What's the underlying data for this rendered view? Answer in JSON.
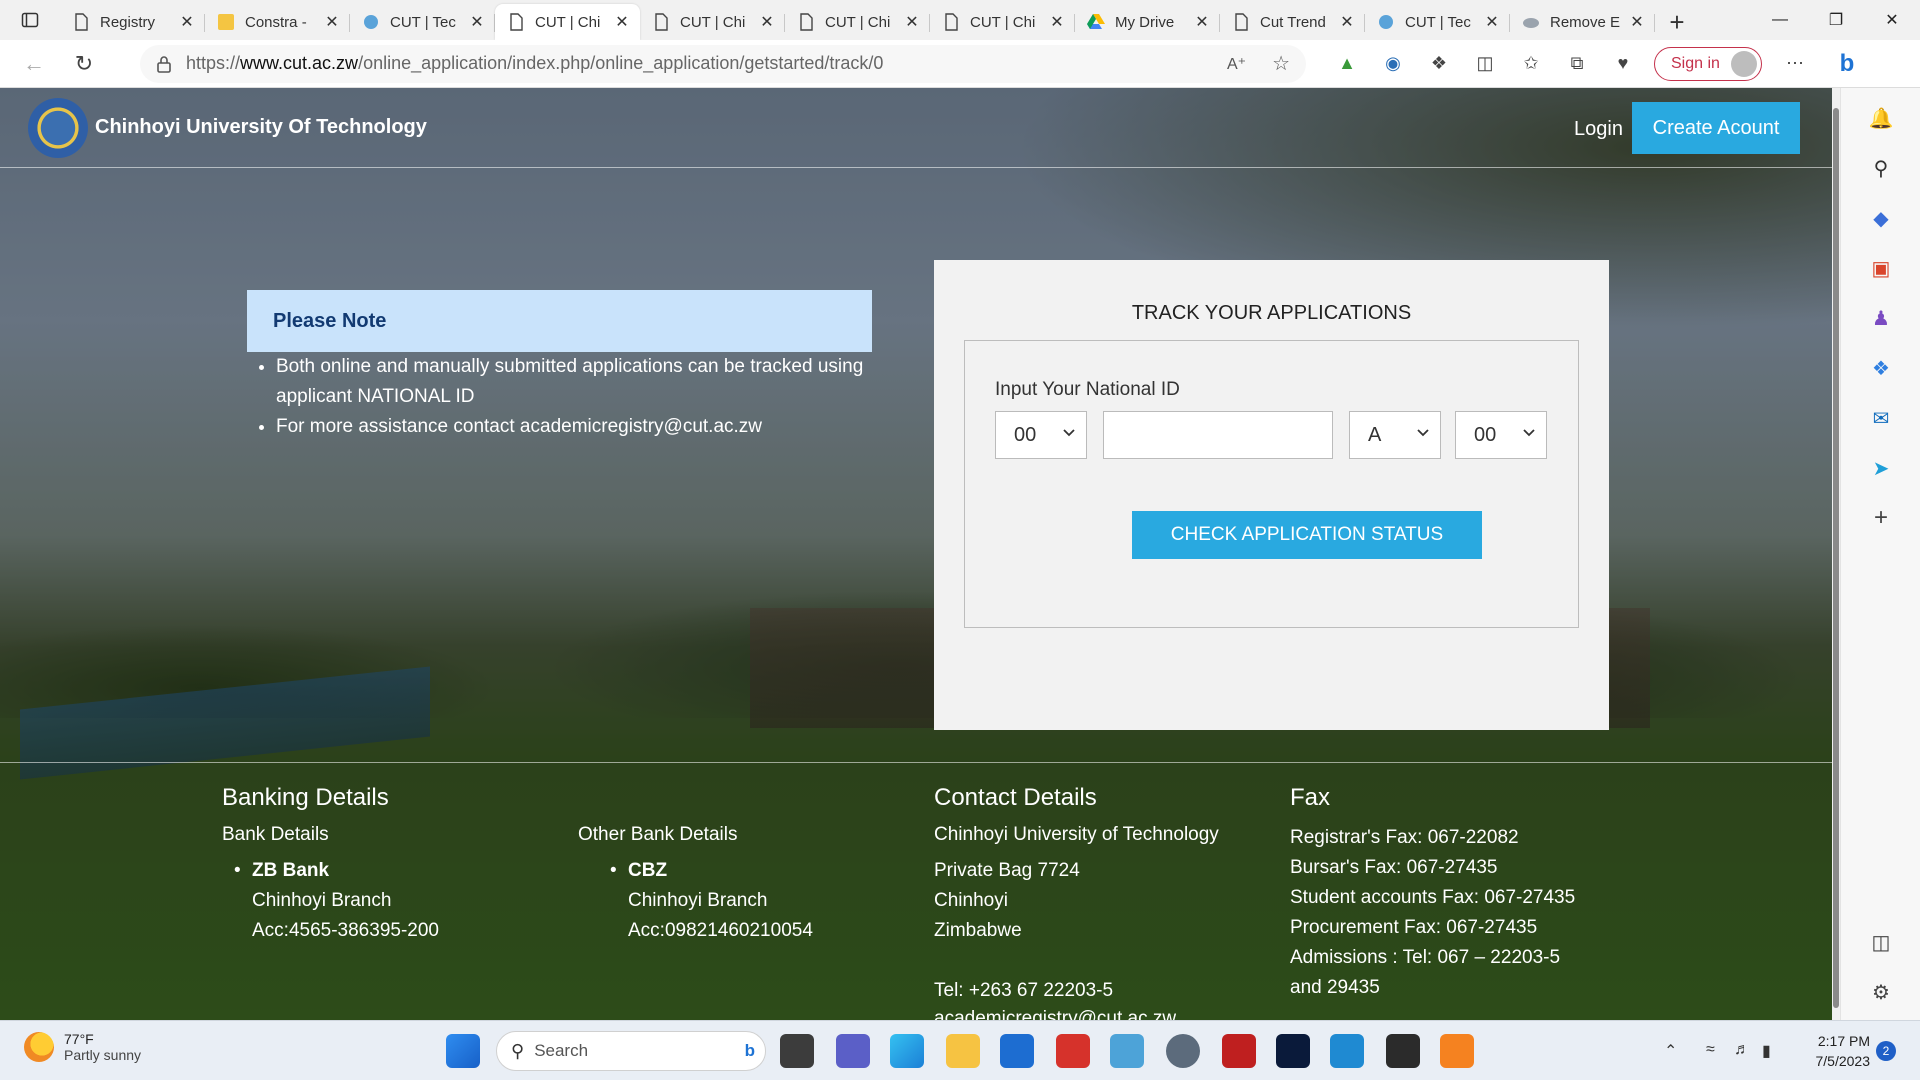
{
  "browser": {
    "tabs": [
      {
        "title": "Registry",
        "icon": "page-icon",
        "active": false
      },
      {
        "title": "Constra -",
        "icon": "site-favicon-icon",
        "active": false
      },
      {
        "title": "CUT | Tec",
        "icon": "globe-icon",
        "active": false
      },
      {
        "title": "CUT | Chi",
        "icon": "page-icon",
        "active": true
      },
      {
        "title": "CUT | Chi",
        "icon": "page-icon",
        "active": false
      },
      {
        "title": "CUT | Chi",
        "icon": "page-icon",
        "active": false
      },
      {
        "title": "CUT | Chi",
        "icon": "page-icon",
        "active": false
      },
      {
        "title": "My Drive",
        "icon": "google-drive-icon",
        "active": false
      },
      {
        "title": "Cut Trend",
        "icon": "page-icon",
        "active": false
      },
      {
        "title": "CUT | Tec",
        "icon": "globe-icon",
        "active": false
      },
      {
        "title": "Remove E",
        "icon": "cloud-icon",
        "active": false
      }
    ],
    "url_prefix": "https://",
    "url_host": "www.cut.ac.zw",
    "url_path": "/online_application/index.php/online_application/getstarted/track/0",
    "signin_label": "Sign in"
  },
  "site": {
    "brand": "Chinhoyi University Of Technology",
    "login": "Login",
    "create_account": "Create Acount"
  },
  "note": {
    "heading": "Please Note",
    "items": [
      "Both online and manually submitted applications can be tracked using applicant NATIONAL ID",
      "For more assistance contact academicregistry@cut.ac.zw"
    ]
  },
  "track": {
    "title": "TRACK YOUR APPLICATIONS",
    "label": "Input Your National ID",
    "select1": "00",
    "input_value": "",
    "select_letter": "A",
    "select2": "00",
    "button": "CHECK APPLICATION STATUS"
  },
  "footer": {
    "banking_heading": "Banking Details",
    "bank_details_label": "Bank Details",
    "bank1_name": "ZB Bank",
    "bank1_branch": "Chinhoyi Branch",
    "bank1_acc": "Acc:4565-386395-200",
    "other_bank_label": "Other Bank Details",
    "bank2_name": "CBZ",
    "bank2_branch": "Chinhoyi Branch",
    "bank2_acc": "Acc:09821460210054",
    "contact_heading": "Contact Details",
    "contact_org": "Chinhoyi University of Technology",
    "contact_lines": [
      "Private Bag 7724",
      "Chinhoyi",
      "Zimbabwe"
    ],
    "contact_tel": "Tel: +263 67 22203-5",
    "contact_email_partial": "academicregistry@cut.ac.zw",
    "fax_heading": "Fax",
    "fax_lines": [
      "Registrar's Fax: 067-22082",
      "Bursar's Fax: 067-27435",
      "Student accounts Fax: 067-27435",
      "Procurement Fax: 067-27435",
      "Admissions : Tel: 067 – 22203-5",
      "and 29435"
    ]
  },
  "taskbar": {
    "weather_temp": "77°F",
    "weather_desc": "Partly sunny",
    "search_placeholder": "Search",
    "time": "2:17 PM",
    "date": "7/5/2023",
    "notification_count": "2"
  },
  "colors": {
    "accent_blue": "#29a9e0",
    "note_bg": "#c9e3fb",
    "signin_red": "#c4314b"
  }
}
